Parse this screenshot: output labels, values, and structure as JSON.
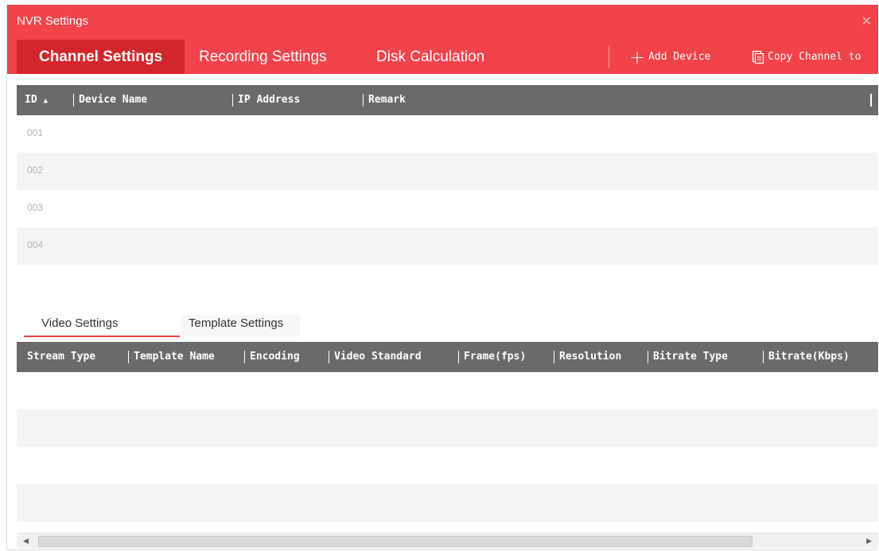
{
  "window": {
    "title": "NVR Settings",
    "close_glyph": "×"
  },
  "tabs": [
    {
      "label": "Channel Settings",
      "active": true
    },
    {
      "label": "Recording Settings",
      "active": false
    },
    {
      "label": "Disk Calculation",
      "active": false
    }
  ],
  "actions": {
    "add_device": {
      "label": "Add Device",
      "icon": "plus-icon"
    },
    "copy_channel": {
      "label": "Copy Channel to",
      "icon": "copy-icon"
    }
  },
  "channel_table": {
    "columns": [
      "ID",
      "Device Name",
      "IP Address",
      "Remark"
    ],
    "sort_column": "ID",
    "sort_direction": "ascending",
    "sort_glyph": "▲",
    "rows": [
      {
        "id": "001"
      },
      {
        "id": "002"
      },
      {
        "id": "003"
      },
      {
        "id": "004"
      }
    ]
  },
  "sub_tabs": [
    {
      "label": "Video Settings",
      "active": true
    },
    {
      "label": "Template Settings",
      "active": false
    }
  ],
  "video_table": {
    "columns": [
      "Stream Type",
      "Template Name",
      "Encoding",
      "Video Standard",
      "Frame(fps)",
      "Resolution",
      "Bitrate Type",
      "Bitrate(Kbps)"
    ]
  },
  "scrollbar": {
    "left_glyph": "◀",
    "right_glyph": "▶"
  },
  "colors": {
    "header": "#f2434a",
    "active_tab": "#d3262c",
    "table_header": "#6a6a6a",
    "row_alt": "#f4f4f4"
  }
}
